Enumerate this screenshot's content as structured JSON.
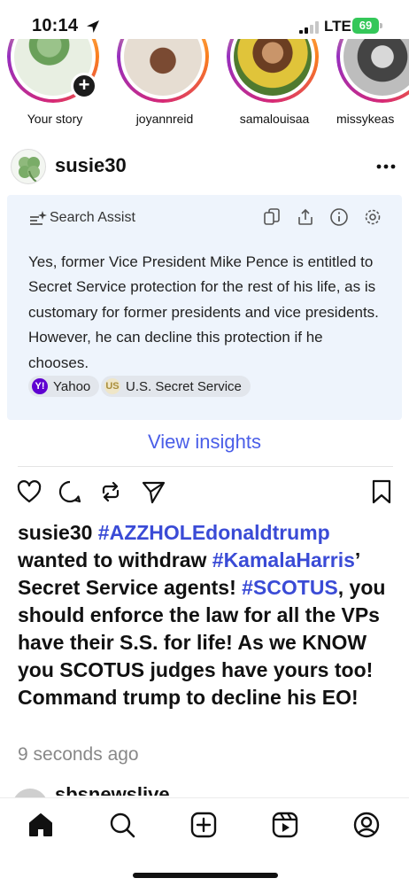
{
  "status_bar": {
    "time": "10:14",
    "network": "LTE",
    "battery": "69"
  },
  "stories": [
    {
      "name": "Your story",
      "is_own": true
    },
    {
      "name": "joyannreid"
    },
    {
      "name": "samalouisaa"
    },
    {
      "name": "missykeas"
    }
  ],
  "post": {
    "username": "susie30",
    "search_assist": {
      "title": "Search Assist",
      "body": "Yes, former Vice President Mike Pence is entitled to Secret Service protection for the rest of his life, as is customary for former presidents and vice presidents. However, he can decline this protection if he chooses.",
      "sources": [
        {
          "label": "Yahoo",
          "logo": "Y!"
        },
        {
          "label": "U.S. Secret Service",
          "logo": "US"
        }
      ]
    },
    "view_insights": "View insights",
    "caption": {
      "username": "susie30",
      "hashtag1": "#AZZHOLEdonaldtrump",
      "text1": " wanted to withdraw ",
      "hashtag2": "#KamalaHarris",
      "text2": "’ Secret Service agents!  ",
      "hashtag3": "#SCOTUS",
      "text3": ", you should enforce the law for all the VPs have their S.S. for life!  As we KNOW you SCOTUS judges have yours too!  Command trump to decline his EO!"
    },
    "timestamp": "9 seconds ago"
  },
  "next_post": {
    "username": "sbsnewslive"
  },
  "colors": {
    "accent": "#4a5ee8",
    "hashtag": "#3a4bd6",
    "assist_bg": "#eef4fc",
    "battery": "#34c759"
  }
}
